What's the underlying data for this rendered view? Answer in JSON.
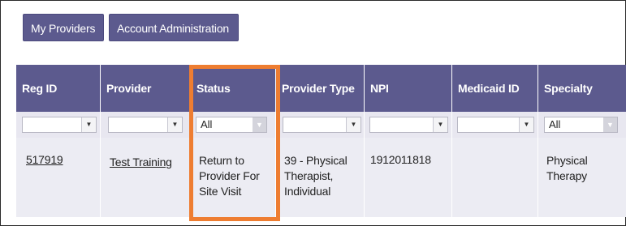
{
  "tabs": {
    "my_providers": "My Providers",
    "account_admin": "Account Administration"
  },
  "table": {
    "columns": [
      "Reg ID",
      "Provider",
      "Status",
      "Provider Type",
      "NPI",
      "Medicaid ID",
      "Specialty"
    ],
    "filters": {
      "status_selected": "All",
      "specialty_selected": "All"
    },
    "rows": [
      {
        "reg_id": "517919",
        "provider": "Test Training",
        "status": [
          "Return to",
          "Provider For",
          "Site Visit"
        ],
        "provider_type": [
          "39 - Physical",
          "Therapist,",
          "Individual"
        ],
        "npi": "1912011818",
        "medicaid_id": "",
        "specialty": [
          "Physical",
          "Therapy"
        ]
      }
    ]
  },
  "colors": {
    "header_bg": "#5c5a8e",
    "highlight": "#ee7d31"
  }
}
